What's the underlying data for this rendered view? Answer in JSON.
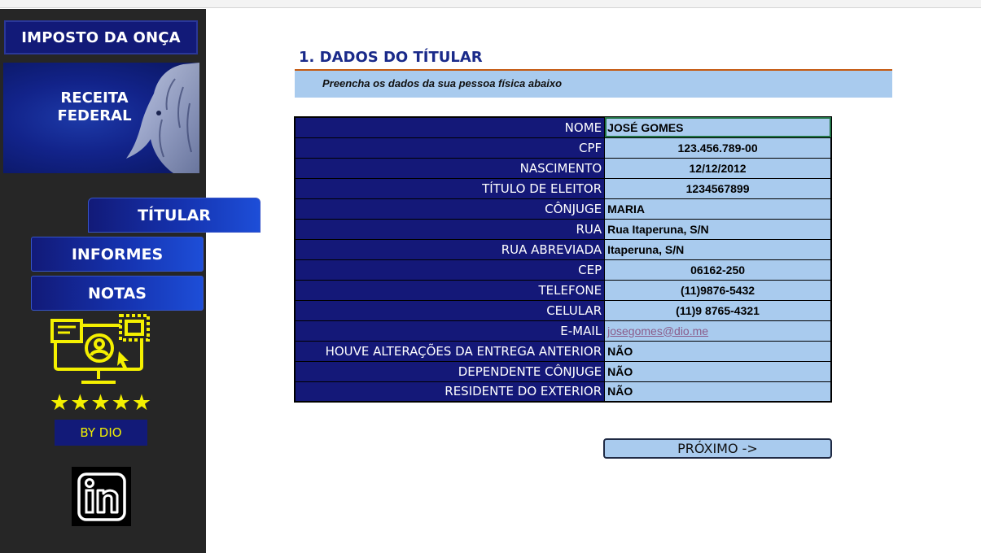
{
  "sidebar": {
    "brand": "IMPOSTO DA ONÇA",
    "banner_line1": "RECEITA",
    "banner_line2": "FEDERAL",
    "nav": {
      "titular": "TÍTULAR",
      "informes": "INFORMES",
      "notas": "NOTAS"
    },
    "stars": "★★★★★",
    "rating": 5,
    "by": "BY DIO",
    "social_icon": "linkedin-icon"
  },
  "main": {
    "title": "1. DADOS DO TÍTULAR",
    "subtitle": "Preencha os dados da sua pessoa física abaixo",
    "fields": [
      {
        "label": "NOME",
        "value": "JOSÉ GOMES"
      },
      {
        "label": "CPF",
        "value": "123.456.789-00"
      },
      {
        "label": "NASCIMENTO",
        "value": "12/12/2012"
      },
      {
        "label": "TÍTULO DE ELEITOR",
        "value": "1234567899"
      },
      {
        "label": "CÔNJUGE",
        "value": "MARIA"
      },
      {
        "label": "RUA",
        "value": "Rua Itaperuna, S/N"
      },
      {
        "label": "RUA ABREVIADA",
        "value": "Itaperuna, S/N"
      },
      {
        "label": "CEP",
        "value": "06162-250"
      },
      {
        "label": "TELEFONE",
        "value": "(11)9876-5432"
      },
      {
        "label": "CELULAR",
        "value": "(11)9 8765-4321"
      },
      {
        "label": "E-MAIL",
        "value": "josegomes@dio.me"
      },
      {
        "label": "HOUVE ALTERAÇÕES DA ENTREGA ANTERIOR",
        "value": "NÃO"
      },
      {
        "label": "DEPENDENTE CÔNJUGE",
        "value": "NÃO"
      },
      {
        "label": "RESIDENTE DO EXTERIOR",
        "value": "NÃO"
      }
    ],
    "next_button": "PRÓXIMO ->"
  },
  "colors": {
    "navy": "#141878",
    "light_blue": "#a9cbee",
    "accent_orange": "#c55a11",
    "sidebar_bg": "#262626",
    "star_yellow": "#f4f000"
  }
}
